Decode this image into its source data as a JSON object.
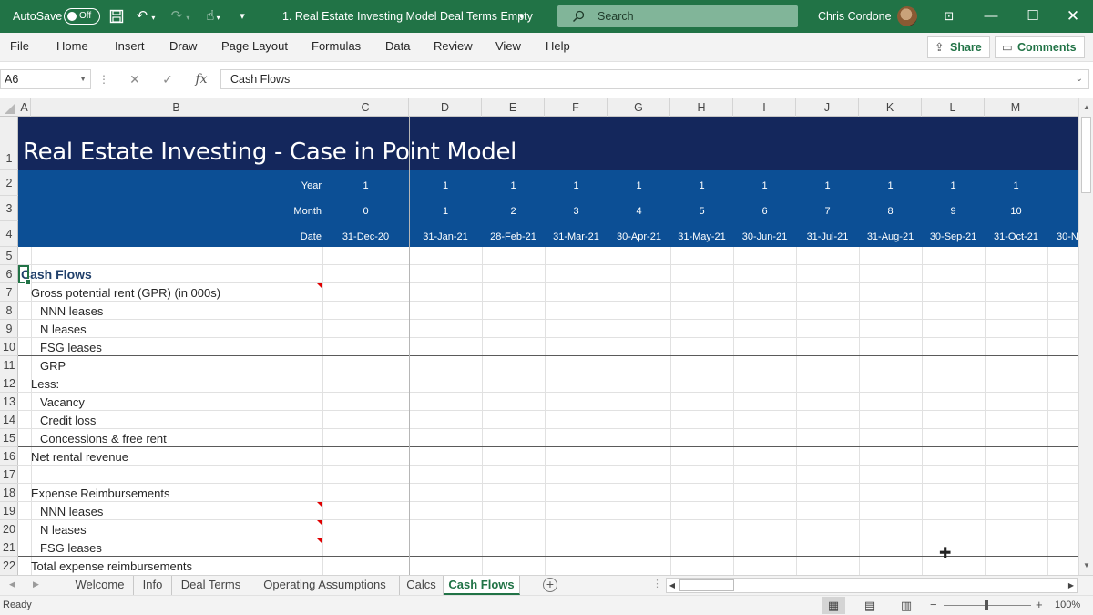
{
  "titlebar": {
    "autosave_label": "AutoSave",
    "autosave_state": "Off",
    "doc_title": "1. Real Estate Investing Model Deal Terms Empty",
    "search_placeholder": "Search",
    "user_name": "Chris Cordone",
    "bg_color": "#217346"
  },
  "menu": {
    "items": [
      "File",
      "Home",
      "Insert",
      "Draw",
      "Page Layout",
      "Formulas",
      "Data",
      "Review",
      "View",
      "Help"
    ],
    "share": "Share",
    "comments": "Comments"
  },
  "formula_bar": {
    "name_box": "A6",
    "fx": "fx",
    "content": "Cash Flows"
  },
  "columns": [
    "A",
    "B",
    "C",
    "D",
    "E",
    "F",
    "G",
    "H",
    "I",
    "J",
    "K",
    "L",
    "M"
  ],
  "rows": [
    "1",
    "2",
    "3",
    "4",
    "5",
    "6",
    "7",
    "8",
    "9",
    "10",
    "11",
    "12",
    "13",
    "14",
    "15",
    "16",
    "17",
    "18",
    "19",
    "20",
    "21",
    "22"
  ],
  "sheet": {
    "title": "Real Estate Investing - Case in Point Model",
    "header_labels": {
      "year": "Year",
      "month": "Month",
      "date": "Date"
    },
    "timeline": {
      "year": [
        "1",
        "1",
        "1",
        "1",
        "1",
        "1",
        "1",
        "1",
        "1",
        "1",
        "1"
      ],
      "month": [
        "0",
        "1",
        "2",
        "3",
        "4",
        "5",
        "6",
        "7",
        "8",
        "9",
        "10"
      ],
      "date": [
        "31-Dec-20",
        "31-Jan-21",
        "28-Feb-21",
        "31-Mar-21",
        "30-Apr-21",
        "31-May-21",
        "30-Jun-21",
        "31-Jul-21",
        "31-Aug-21",
        "30-Sep-21",
        "31-Oct-21"
      ],
      "partial_next_date": "30-N"
    },
    "section_title": "Cash Flows",
    "line_items": [
      "Gross potential rent (GPR) (in 000s)",
      "NNN leases",
      "N leases",
      "FSG leases",
      "GRP",
      "Less:",
      "Vacancy",
      "Credit loss",
      "Concessions & free rent",
      "Net rental revenue",
      "Expense Reimbursements",
      "NNN leases",
      "N leases",
      "FSG leases",
      "Total expense reimbursements"
    ],
    "banner_dark": "#14275c",
    "banner_blue": "#0c4f95"
  },
  "sheet_tabs": {
    "tabs": [
      "Welcome",
      "Info",
      "Deal Terms",
      "Operating Assumptions",
      "Calcs",
      "Cash Flows"
    ],
    "active": "Cash Flows"
  },
  "status": {
    "ready": "Ready",
    "zoom": "100%"
  }
}
